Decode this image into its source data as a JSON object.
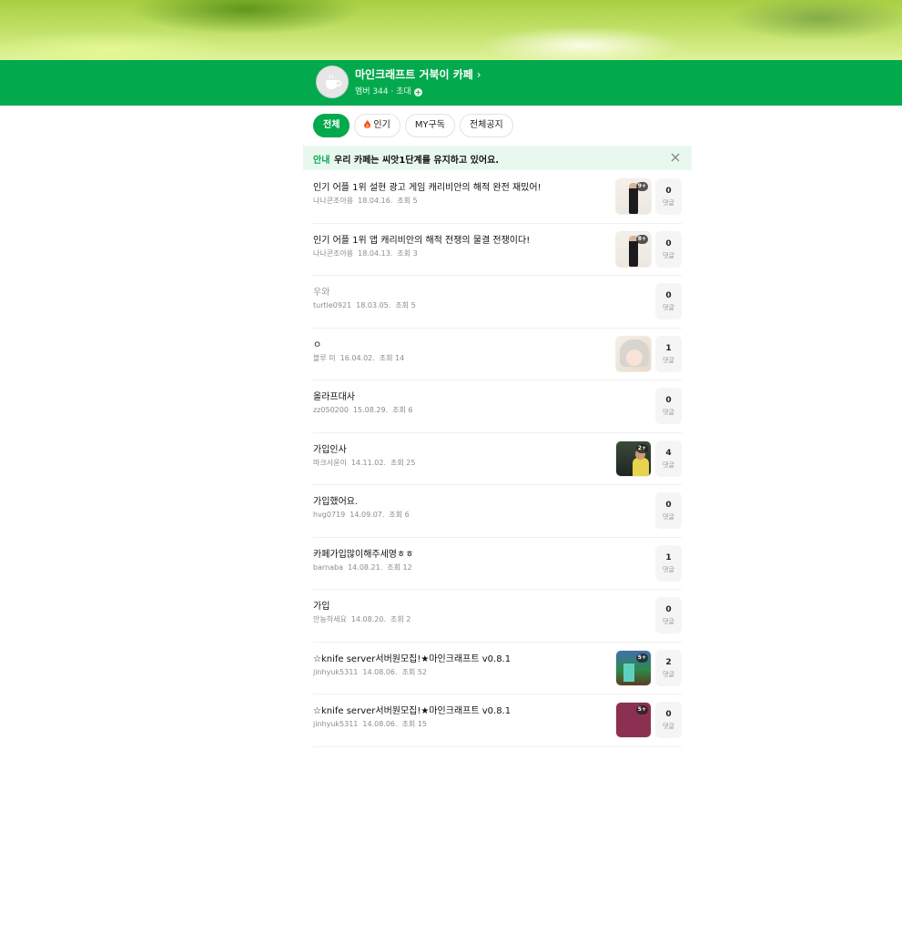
{
  "cafe": {
    "name": "마인크래프트 거북이 카페",
    "chevron": "›",
    "member_label": "멤버 344",
    "separator": "·",
    "invite_label": "초대",
    "invite_icon": "+",
    "colors": {
      "brand": "#03a94d",
      "notice_bg": "#e9f8ef"
    }
  },
  "tabs": [
    {
      "label": "전체",
      "active": true
    },
    {
      "label": "인기",
      "icon": "fire-icon"
    },
    {
      "label": "MY구독"
    },
    {
      "label": "전체공지"
    }
  ],
  "notice": {
    "tag": "안내",
    "text": "우리 카페는 씨앗1단계를 유지하고 있어요.",
    "close_icon": "close-icon"
  },
  "comment_label": "댓글",
  "posts": [
    {
      "title": "인기 어플 1위 설현 광고 게임 캐리비안의 해적 완전 재밌어!",
      "author": "나나콘조아용",
      "date": "18.04.16.",
      "views": "조회 5",
      "comments": "0",
      "thumb_badge": "9+"
    },
    {
      "title": "인기 어플 1위 앱 캐리비안의 해적 전쟁의 물결 전쟁이다!",
      "author": "나나콘조아용",
      "date": "18.04.13.",
      "views": "조회 3",
      "comments": "0",
      "thumb_badge": "8+"
    },
    {
      "title": "우와",
      "author": "turtle0921",
      "date": "18.03.05.",
      "views": "조회 5",
      "comments": "0"
    },
    {
      "title": "ㅇ",
      "author": "블루 미",
      "date": "16.04.02.",
      "views": "조회 14",
      "comments": "1"
    },
    {
      "title": "올라프대사",
      "author": "zz050200",
      "date": "15.08.29.",
      "views": "조회 6",
      "comments": "0"
    },
    {
      "title": "가입인사",
      "author": "마크서윤이",
      "date": "14.11.02.",
      "views": "조회 25",
      "comments": "4",
      "thumb_badge": "2+"
    },
    {
      "title": "가입했어요.",
      "author": "hvg0719",
      "date": "14.09.07.",
      "views": "조회 6",
      "comments": "0"
    },
    {
      "title": "카페가입많이해주세영ㅎㅎ",
      "author": "barnaba",
      "date": "14.08.21.",
      "views": "조회 12",
      "comments": "1"
    },
    {
      "title": "가입",
      "author": "안뇽하세요",
      "date": "14.08.20.",
      "views": "조회 2",
      "comments": "0"
    },
    {
      "title": "☆knife server서버원모집!★마인크래프트 v0.8.1",
      "author": "jinhyuk5311",
      "date": "14.08.06.",
      "views": "조회 52",
      "comments": "2",
      "thumb_badge": "5+"
    },
    {
      "title": "☆knife server서버원모집!★마인크래프트 v0.8.1",
      "author": "jinhyuk5311",
      "date": "14.08.06.",
      "views": "조회 15",
      "comments": "0",
      "thumb_badge": "5+"
    }
  ]
}
